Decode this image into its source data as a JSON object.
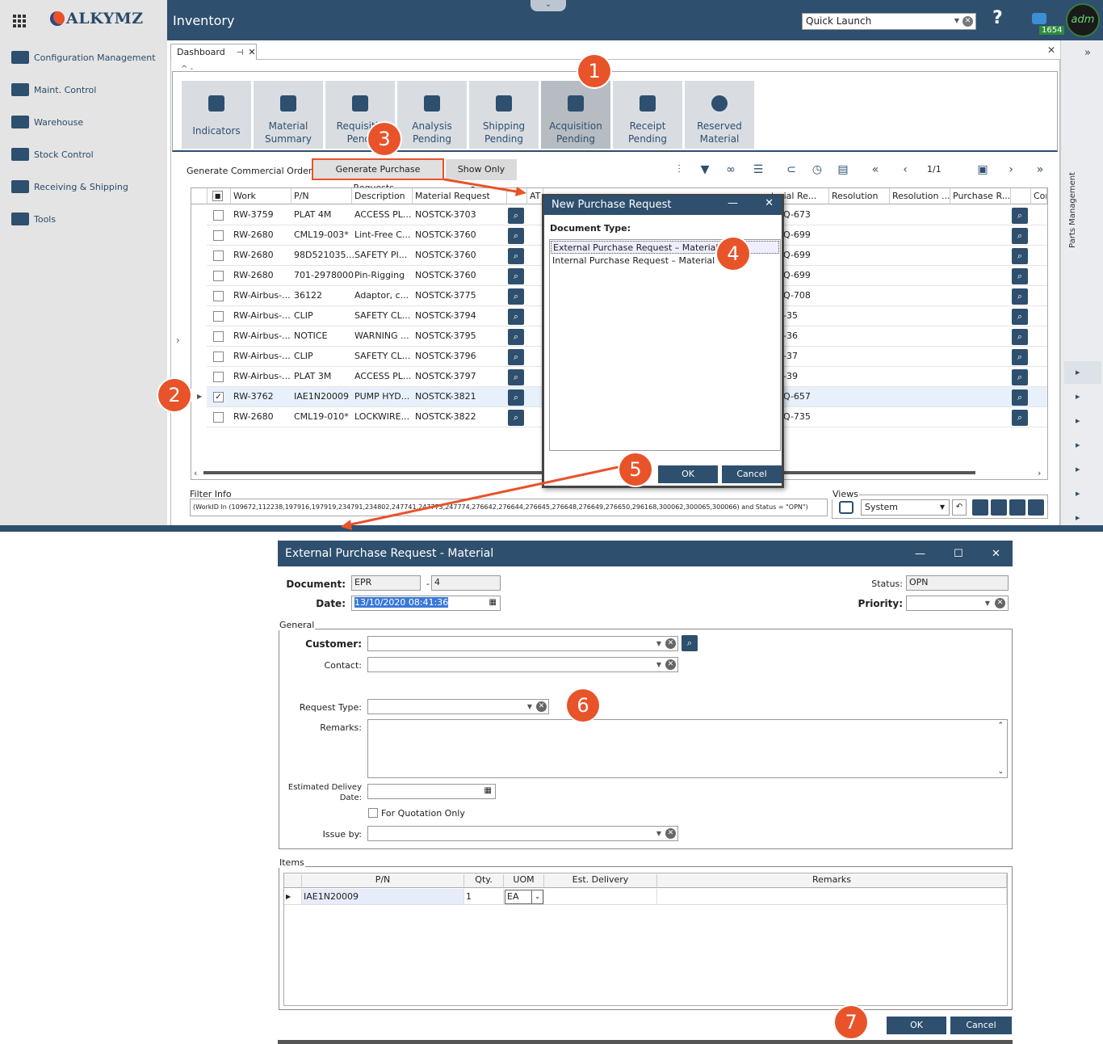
{
  "app": {
    "logo_text": "ALKYMZ",
    "module_title": "Inventory",
    "quick_launch": "Quick Launch",
    "badge_count": "1654",
    "avatar_text": "adm"
  },
  "sidebar": {
    "items": [
      {
        "label": "Configuration Management",
        "icon": "config-icon"
      },
      {
        "label": "Maint. Control",
        "icon": "wrench-icon"
      },
      {
        "label": "Warehouse",
        "icon": "warehouse-icon"
      },
      {
        "label": "Stock Control",
        "icon": "stock-icon"
      },
      {
        "label": "Receiving & Shipping",
        "icon": "truck-icon"
      },
      {
        "label": "Tools",
        "icon": "tools-icon"
      }
    ]
  },
  "right_panel": {
    "label": "Parts Management"
  },
  "dashboard": {
    "tab_label": "Dashboard",
    "tiles": [
      {
        "l1": "Indicators",
        "l2": ""
      },
      {
        "l1": "Material",
        "l2": "Summary"
      },
      {
        "l1": "Requisitio",
        "l2": "Pendi"
      },
      {
        "l1": "Analysis",
        "l2": "Pending"
      },
      {
        "l1": "Shipping",
        "l2": "Pending"
      },
      {
        "l1": "Acquisition",
        "l2": "Pending"
      },
      {
        "l1": "Receipt",
        "l2": "Pending"
      },
      {
        "l1": "Reserved",
        "l2": "Material"
      }
    ],
    "toolbar": {
      "gen_commercial": "Generate Commercial Orders...",
      "gen_po": "Generate Purchase Requests...",
      "show_open": "Show Only Open",
      "page": "1/1"
    }
  },
  "table": {
    "headers": [
      "Work",
      "P/N",
      "Description",
      "Material Request",
      "AT",
      "terial Re...",
      "Resolution",
      "Resolution ...",
      "Purchase R...",
      "Con"
    ],
    "rows": [
      {
        "work": "RW-3759",
        "pn": "PLAT 4M",
        "desc": "ACCESS PL...",
        "mr": "NOSTCK-3703",
        "mre": "Q-673",
        "checked": false
      },
      {
        "work": "RW-2680",
        "pn": "CML19-003*",
        "desc": "Lint-Free C...",
        "mr": "NOSTCK-3760",
        "mre": "Q-699",
        "checked": false
      },
      {
        "work": "RW-2680",
        "pn": "98D521035...",
        "desc": "SAFETY PI...",
        "mr": "NOSTCK-3760",
        "mre": "Q-699",
        "checked": false
      },
      {
        "work": "RW-2680",
        "pn": "701-2978000",
        "desc": "Pin-Rigging",
        "mr": "NOSTCK-3760",
        "mre": "Q-699",
        "checked": false
      },
      {
        "work": "RW-Airbus-...",
        "pn": "36122",
        "desc": "Adaptor, c...",
        "mr": "NOSTCK-3775",
        "mre": "Q-708",
        "checked": false
      },
      {
        "work": "RW-Airbus-...",
        "pn": "CLIP",
        "desc": "SAFETY CL...",
        "mr": "NOSTCK-3794",
        "mre": "-35",
        "checked": false
      },
      {
        "work": "RW-Airbus-...",
        "pn": "NOTICE",
        "desc": "WARNING ...",
        "mr": "NOSTCK-3795",
        "mre": "-36",
        "checked": false
      },
      {
        "work": "RW-Airbus-...",
        "pn": "CLIP",
        "desc": "SAFETY CL...",
        "mr": "NOSTCK-3796",
        "mre": "-37",
        "checked": false
      },
      {
        "work": "RW-Airbus-...",
        "pn": "PLAT 3M",
        "desc": "ACCESS PL...",
        "mr": "NOSTCK-3797",
        "mre": "-39",
        "checked": false
      },
      {
        "work": "RW-3762",
        "pn": "IAE1N20009",
        "desc": "PUMP HYD...",
        "mr": "NOSTCK-3821",
        "mre": "Q-657",
        "checked": true
      },
      {
        "work": "RW-2680",
        "pn": "CML19-010*",
        "desc": "LOCKWIRE...",
        "mr": "NOSTCK-3822",
        "mre": "Q-735",
        "checked": false
      }
    ]
  },
  "filter": {
    "label": "Filter Info",
    "text": "(WorkID In (109672,112238,197916,197919,234791,234802,247741,247773,247774,276642,276644,276645,276648,276649,276650,296168,300062,300065,300066) and Status = \"OPN\")"
  },
  "views": {
    "label": "Views",
    "selected": "System"
  },
  "npr_dialog": {
    "title": "New Purchase Request",
    "doc_type_label": "Document Type:",
    "options": [
      "External Purchase Request – Material",
      "Internal Purchase Request – Material"
    ],
    "ok": "OK",
    "cancel": "Cancel"
  },
  "epr_dialog": {
    "title": "External Purchase Request - Material",
    "document_label": "Document:",
    "doc_prefix": "EPR",
    "doc_sep": "-",
    "doc_number": "4",
    "date_label": "Date:",
    "date_value": "13/10/2020 08:41:36",
    "status_label": "Status:",
    "status_value": "OPN",
    "priority_label": "Priority:",
    "general_label": "General",
    "customer_label": "Customer:",
    "contact_label": "Contact:",
    "request_type_label": "Request Type:",
    "remarks_label": "Remarks:",
    "est_delivery_l1": "Estimated Delivey",
    "est_delivery_l2": "Date:",
    "for_quotation": "For Quotation Only",
    "issue_by_label": "Issue by:",
    "items_label": "Items",
    "items_headers": [
      "P/N",
      "Qty.",
      "UOM",
      "Est. Delivery",
      "Remarks"
    ],
    "items_rows": [
      {
        "pn": "IAE1N20009",
        "qty": "1",
        "uom": "EA",
        "delivery": "",
        "remarks": ""
      }
    ],
    "ok": "OK",
    "cancel": "Cancel"
  },
  "markers": [
    "1",
    "2",
    "3",
    "4",
    "5",
    "6",
    "7"
  ],
  "colors": {
    "primary": "#2e4f6e",
    "accent": "#e8532a",
    "sidebar_bg": "#e4e4e4"
  }
}
